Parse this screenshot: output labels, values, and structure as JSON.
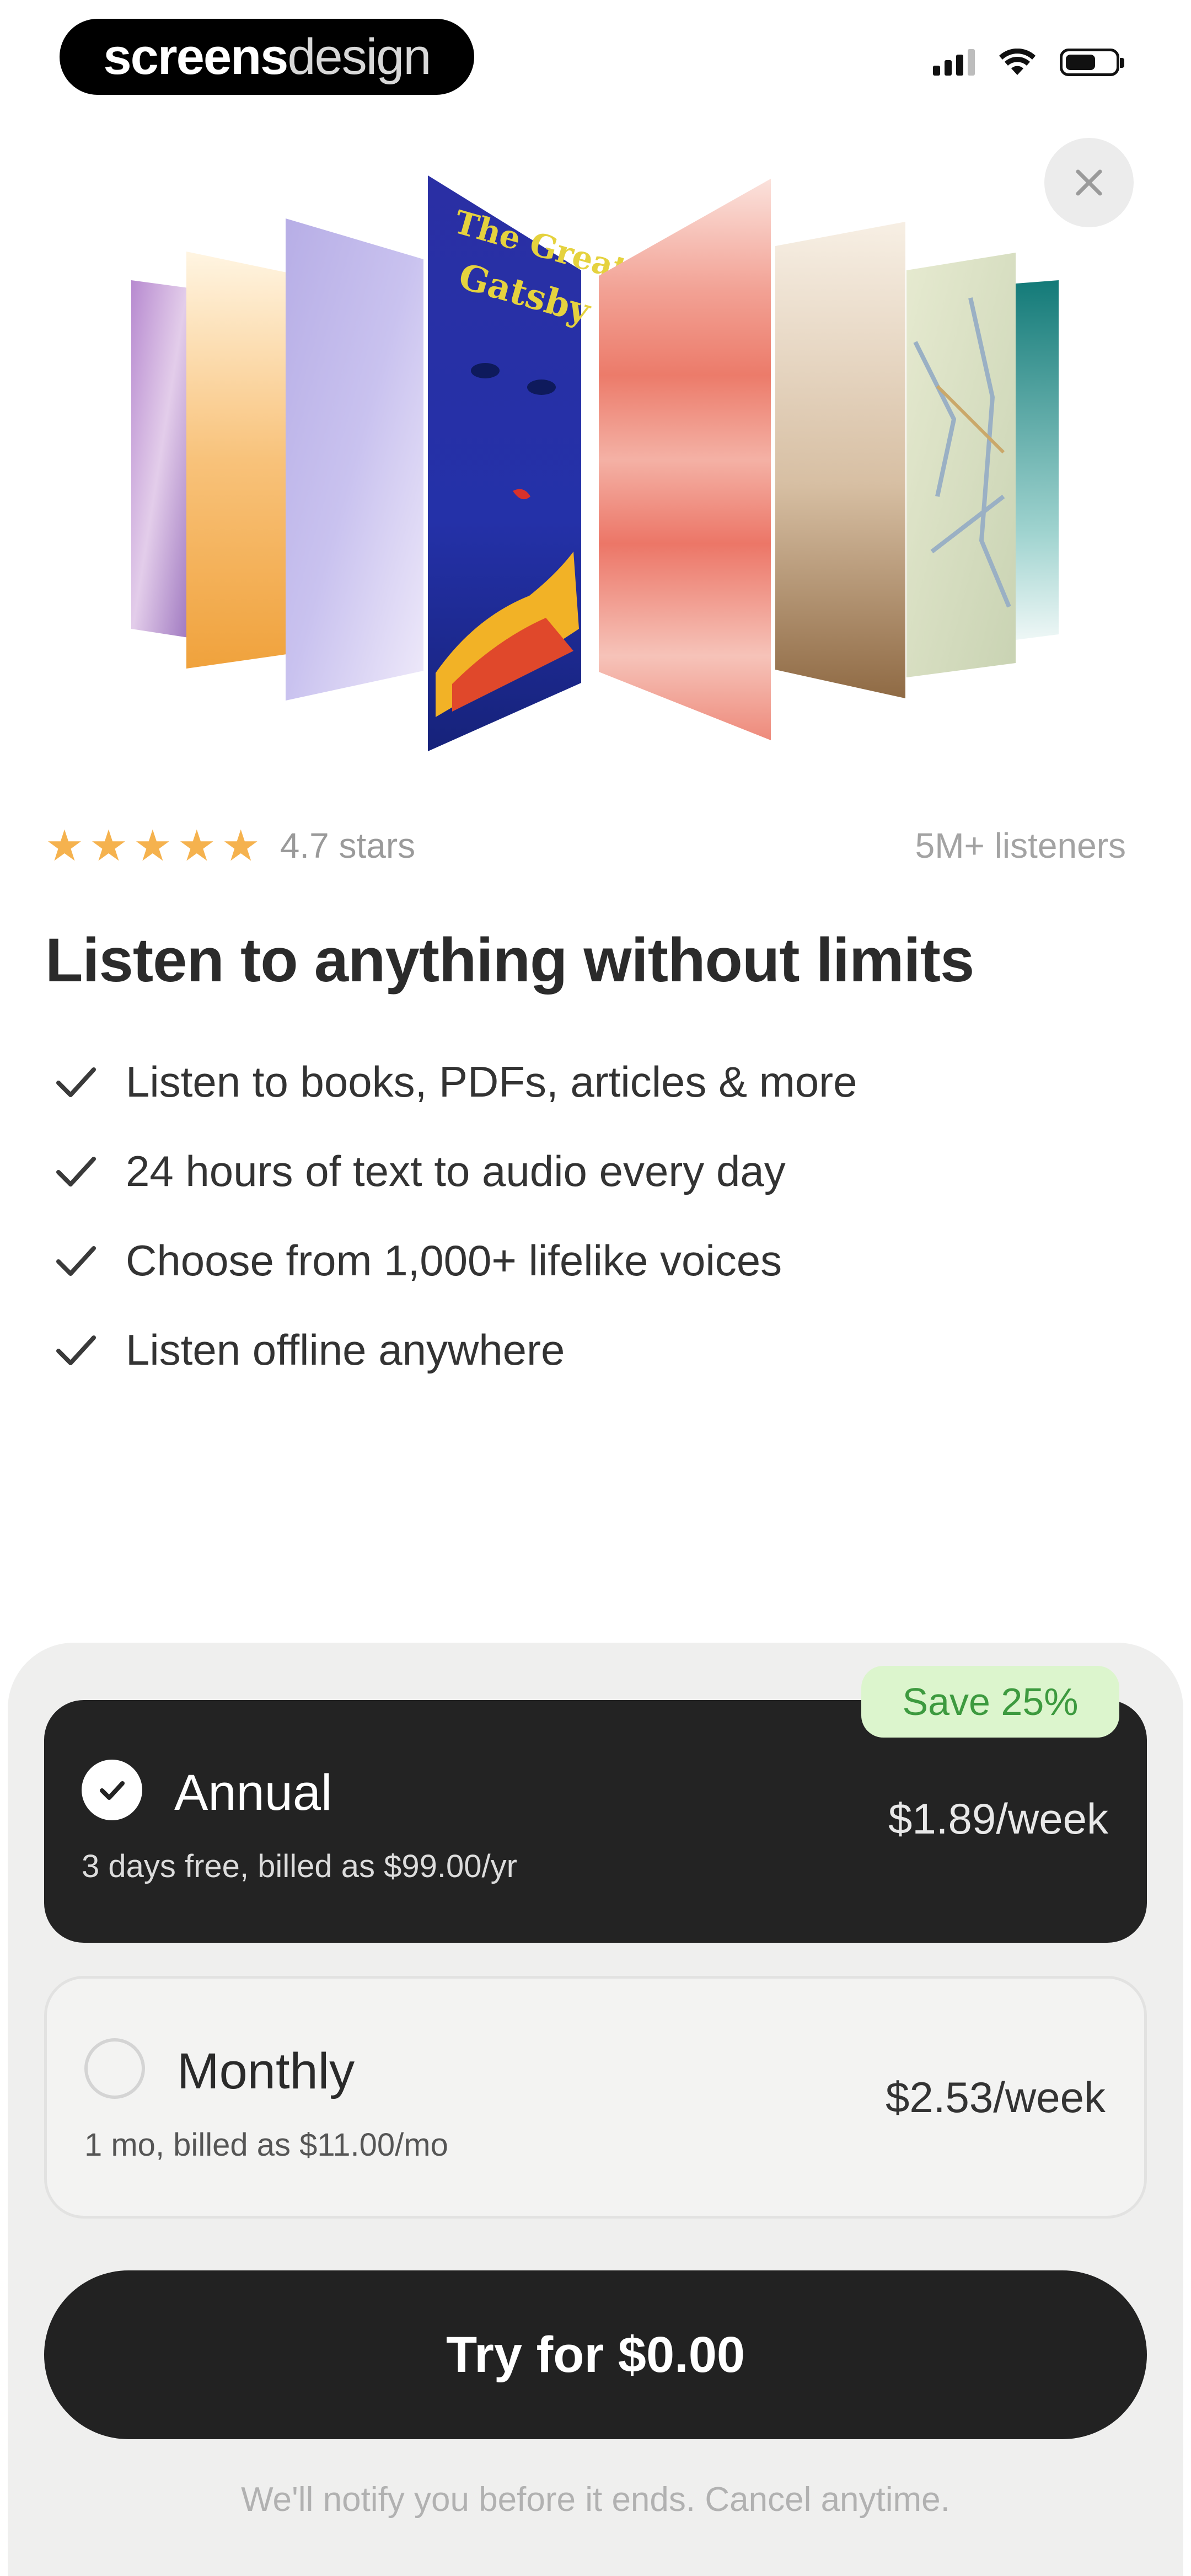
{
  "status_bar": {
    "brand_bold": "screens",
    "brand_light": "design"
  },
  "hero": {
    "rating_text": "4.7 stars",
    "star_count": 5,
    "listeners_text": "5M+ listeners"
  },
  "headline": "Listen to anything without limits",
  "features": [
    "Listen to books, PDFs, articles & more",
    "24 hours of text to audio every day",
    "Choose from 1,000+ lifelike voices",
    "Listen offline anywhere"
  ],
  "plans": {
    "save_badge": "Save 25%",
    "annual": {
      "name": "Annual",
      "description": "3 days free, billed as $99.00/yr",
      "price": "$1.89/week",
      "selected": true
    },
    "monthly": {
      "name": "Monthly",
      "description": "1 mo, billed as $11.00/mo",
      "price": "$2.53/week",
      "selected": false
    }
  },
  "cta_label": "Try for $0.00",
  "footnote": "We'll notify you before it ends. Cancel anytime.",
  "colors": {
    "accent_dark": "#222222",
    "star": "#f5b24e",
    "save_badge_bg": "#dcf5cd",
    "save_badge_text": "#3d9a3f",
    "sheet_bg": "#efefee"
  }
}
